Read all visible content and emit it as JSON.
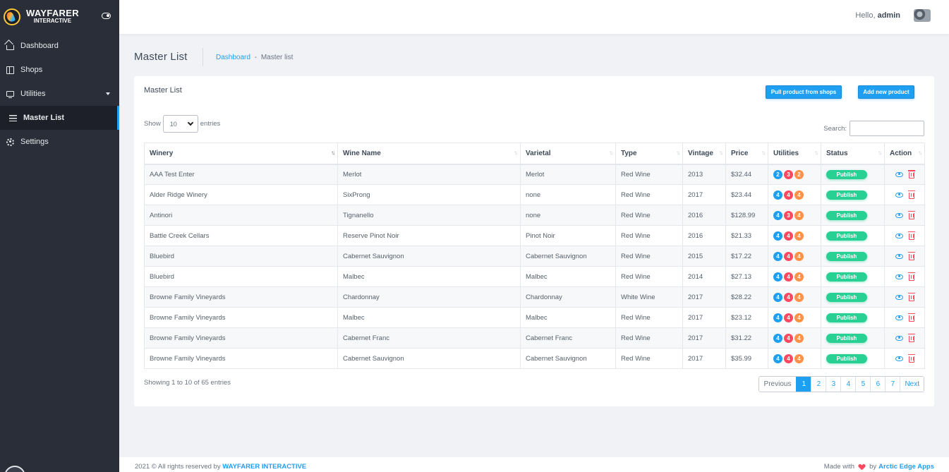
{
  "brand": {
    "name": "WAYFARER",
    "sub": "INTERACTIVE"
  },
  "sidebar": {
    "items": [
      {
        "label": "Dashboard",
        "icon": "home-icon"
      },
      {
        "label": "Shops",
        "icon": "shop-icon"
      },
      {
        "label": "Utilities",
        "icon": "monitor-icon"
      },
      {
        "label": "Master List",
        "icon": "list-icon",
        "active": true
      },
      {
        "label": "Settings",
        "icon": "gear-icon"
      }
    ]
  },
  "topbar": {
    "greeting": "Hello,",
    "user": "admin"
  },
  "page": {
    "title": "Master List",
    "breadcrumb": {
      "home": "Dashboard",
      "sep": "-",
      "current": "Master list"
    }
  },
  "card": {
    "title": "Master List",
    "pull_button": "Pull product from shops",
    "add_button": "Add new product",
    "show_label": "Show",
    "entries_value": "10",
    "entries_label": "entries",
    "search_label": "Search:",
    "search_value": ""
  },
  "table": {
    "columns": [
      "Winery",
      "Wine Name",
      "Varietal",
      "Type",
      "Vintage",
      "Price",
      "Utilities",
      "Status",
      "Action"
    ],
    "rows": [
      {
        "winery": "AAA Test Enter",
        "wine": "Merlot",
        "varietal": "Merlot",
        "type": "Red Wine",
        "vintage": "2013",
        "price": "$32.44",
        "u": [
          "2",
          "3",
          "2"
        ],
        "status": "Publish"
      },
      {
        "winery": "Alder Ridge Winery",
        "wine": "SixProng",
        "varietal": "none",
        "type": "Red Wine",
        "vintage": "2017",
        "price": "$23.44",
        "u": [
          "4",
          "4",
          "4"
        ],
        "status": "Publish"
      },
      {
        "winery": "Antinori",
        "wine": "Tignanello",
        "varietal": "none",
        "type": "Red Wine",
        "vintage": "2016",
        "price": "$128.99",
        "u": [
          "4",
          "3",
          "4"
        ],
        "status": "Publish"
      },
      {
        "winery": "Battle Creek Cellars",
        "wine": "Reserve Pinot Noir",
        "varietal": "Pinot Noir",
        "type": "Red Wine",
        "vintage": "2016",
        "price": "$21.33",
        "u": [
          "4",
          "4",
          "4"
        ],
        "status": "Publish"
      },
      {
        "winery": "Bluebird",
        "wine": "Cabernet Sauvignon",
        "varietal": "Cabernet Sauvignon",
        "type": "Red Wine",
        "vintage": "2015",
        "price": "$17.22",
        "u": [
          "4",
          "4",
          "4"
        ],
        "status": "Publish"
      },
      {
        "winery": "Bluebird",
        "wine": "Malbec",
        "varietal": "Malbec",
        "type": "Red Wine",
        "vintage": "2014",
        "price": "$27.13",
        "u": [
          "4",
          "4",
          "4"
        ],
        "status": "Publish"
      },
      {
        "winery": "Browne Family Vineyards",
        "wine": "Chardonnay",
        "varietal": "Chardonnay",
        "type": "White Wine",
        "vintage": "2017",
        "price": "$28.22",
        "u": [
          "4",
          "4",
          "4"
        ],
        "status": "Publish"
      },
      {
        "winery": "Browne Family Vineyards",
        "wine": "Malbec",
        "varietal": "Malbec",
        "type": "Red Wine",
        "vintage": "2017",
        "price": "$23.12",
        "u": [
          "4",
          "4",
          "4"
        ],
        "status": "Publish"
      },
      {
        "winery": "Browne Family Vineyards",
        "wine": "Cabernet Franc",
        "varietal": "Cabernet Franc",
        "type": "Red Wine",
        "vintage": "2017",
        "price": "$31.22",
        "u": [
          "4",
          "4",
          "4"
        ],
        "status": "Publish"
      },
      {
        "winery": "Browne Family Vineyards",
        "wine": "Cabernet Sauvignon",
        "varietal": "Cabernet Sauvignon",
        "type": "Red Wine",
        "vintage": "2017",
        "price": "$35.99",
        "u": [
          "4",
          "4",
          "4"
        ],
        "status": "Publish"
      }
    ]
  },
  "info": "Showing 1 to 10 of 65 entries",
  "pagination": {
    "prev": "Previous",
    "pages": [
      "1",
      "2",
      "3",
      "4",
      "5",
      "6",
      "7"
    ],
    "next": "Next",
    "active": "1"
  },
  "footer": {
    "left_prefix": "2021 © All rights reserved by",
    "left_brand": "WAYFARER INTERACTIVE",
    "made_with": "Made with",
    "by": "by",
    "right_brand": "Arctic Edge Apps"
  },
  "colors": {
    "accent": "#1e9ff2",
    "success": "#28d094",
    "danger": "#ff4961",
    "warning": "#ff9149",
    "sidebar": "#2a2e38"
  }
}
